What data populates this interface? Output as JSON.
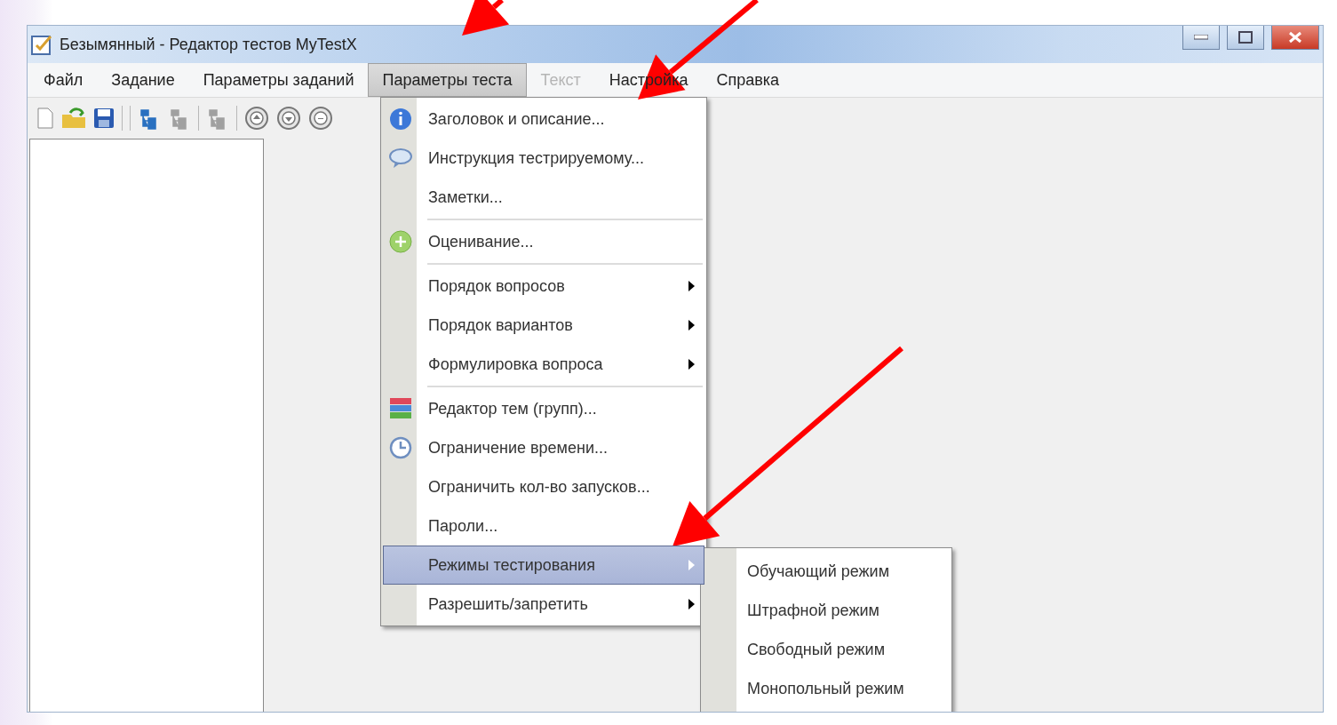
{
  "window": {
    "title": "Безымянный - Редактор тестов MyTestX"
  },
  "menu_bar": [
    {
      "label": "Файл",
      "selected": false,
      "disabled": false
    },
    {
      "label": "Задание",
      "selected": false,
      "disabled": false
    },
    {
      "label": "Параметры заданий",
      "selected": false,
      "disabled": false
    },
    {
      "label": "Параметры теста",
      "selected": true,
      "disabled": false
    },
    {
      "label": "Текст",
      "selected": false,
      "disabled": true
    },
    {
      "label": "Настройка",
      "selected": false,
      "disabled": false
    },
    {
      "label": "Справка",
      "selected": false,
      "disabled": false
    }
  ],
  "dropdown": [
    {
      "kind": "command",
      "label": "Заголовок и описание...",
      "selected": false
    },
    {
      "kind": "command",
      "label": "Инструкция тестрируемому...",
      "selected": false
    },
    {
      "kind": "command",
      "label": "Заметки...",
      "selected": false
    },
    {
      "kind": "separator"
    },
    {
      "kind": "command",
      "label": "Оценивание...",
      "selected": false
    },
    {
      "kind": "separator"
    },
    {
      "kind": "submenu",
      "label": "Порядок вопросов",
      "selected": false
    },
    {
      "kind": "submenu",
      "label": "Порядок вариантов",
      "selected": false
    },
    {
      "kind": "submenu",
      "label": "Формулировка вопроса",
      "selected": false
    },
    {
      "kind": "separator"
    },
    {
      "kind": "command",
      "label": "Редактор тем (групп)...",
      "selected": false
    },
    {
      "kind": "command",
      "label": "Ограничение времени...",
      "selected": false
    },
    {
      "kind": "command",
      "label": "Ограничить кол-во запусков...",
      "selected": false
    },
    {
      "kind": "command",
      "label": "Пароли...",
      "selected": false
    },
    {
      "kind": "submenu",
      "label": "Режимы тестирования",
      "selected": true
    },
    {
      "kind": "submenu",
      "label": "Разрешить/запретить",
      "selected": false
    }
  ],
  "submenu": [
    {
      "label": "Обучающий режим"
    },
    {
      "label": "Штрафной режим"
    },
    {
      "label": "Свободный режим"
    },
    {
      "label": "Монопольный режим"
    }
  ]
}
